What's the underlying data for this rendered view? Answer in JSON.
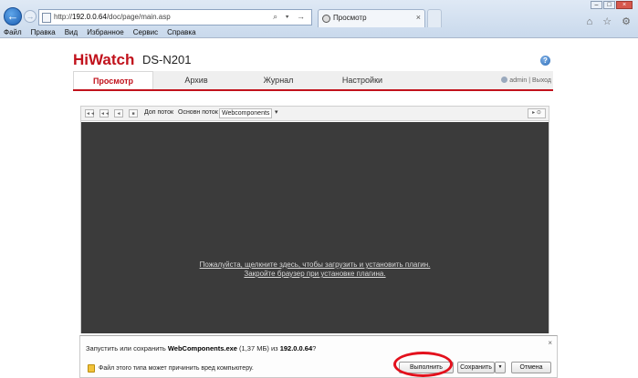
{
  "browser": {
    "url_prefix": "http://",
    "url_host": "192.0.0.64",
    "url_path": "/doc/page/main.asp",
    "address_controls": "⌕ ▾ →",
    "tab_title": "Просмотр",
    "tab_close": "×",
    "menu": [
      "Файл",
      "Правка",
      "Вид",
      "Избранное",
      "Сервис",
      "Справка"
    ],
    "window_buttons": [
      "–",
      "□",
      "×"
    ],
    "right_icons": "⌂ ☆ ⚙"
  },
  "header": {
    "logo_part1": "Hi",
    "logo_part2": "Watch",
    "model": "DS-N201",
    "help": "?"
  },
  "nav": {
    "tabs": [
      "Просмотр",
      "Архив",
      "Журнал",
      "Настройки"
    ],
    "active_tab": "Просмотр",
    "user": "admin",
    "separator": "|",
    "logout": "Выход"
  },
  "player": {
    "toolbar_buttons": [
      "◄◄",
      "◄◄",
      "◄",
      "■"
    ],
    "substream_label": "Доп поток",
    "mainstream_label": "Основн поток",
    "plugin_select": "Webcomponents",
    "right_button": "▸ ⊙",
    "plugin_line1": "Пожалуйста, щелкните здесь, чтобы загрузить и установить плагин.",
    "plugin_line2": "Закройте браузер при установке плагина."
  },
  "download": {
    "msg_prefix": "Запустить или сохранить ",
    "filename": "WebComponents.exe",
    "size": " (1,37 МБ) ",
    "from": " из ",
    "host": "192.0.0.64",
    "suffix": "?",
    "warning": "Файл этого типа может причинить вред компьютеру.",
    "run_label": "Выполнить",
    "save_label": "Сохранить",
    "save_arrow": "▼",
    "cancel_label": "Отмена",
    "close": "×"
  }
}
